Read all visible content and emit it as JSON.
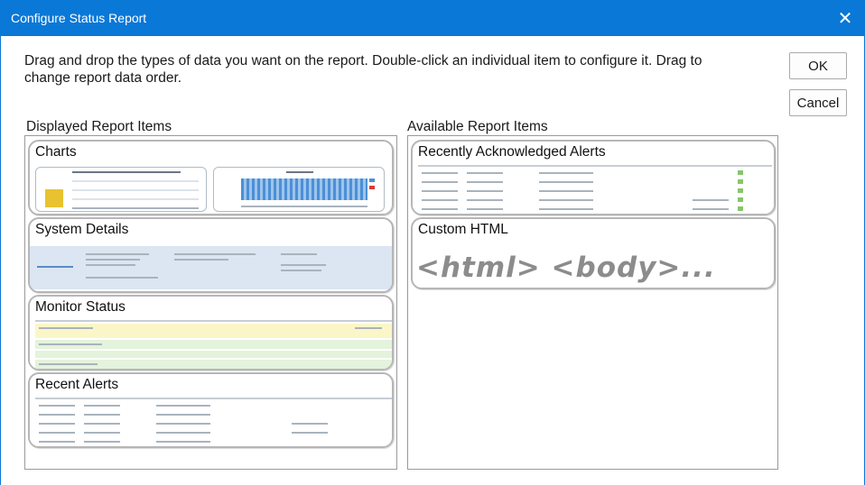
{
  "window": {
    "title": "Configure Status Report",
    "close_glyph": "✕"
  },
  "instructions": "Drag and drop the types of data you want on the report.  Double-click an individual item to configure it. Drag to change report data order.",
  "buttons": {
    "ok": "OK",
    "cancel": "Cancel"
  },
  "displayed": {
    "label": "Displayed Report Items",
    "items": [
      {
        "title": "Charts"
      },
      {
        "title": "System Details"
      },
      {
        "title": "Monitor Status"
      },
      {
        "title": "Recent Alerts"
      }
    ]
  },
  "available": {
    "label": "Available Report Items",
    "items": [
      {
        "title": "Recently Acknowledged Alerts"
      },
      {
        "title": "Custom HTML",
        "preview": "<html> <body>..."
      }
    ]
  },
  "colors": {
    "titlebar": "#0a78d7",
    "accent_green": "#86c66c",
    "accent_yellow": "#e8c230"
  }
}
